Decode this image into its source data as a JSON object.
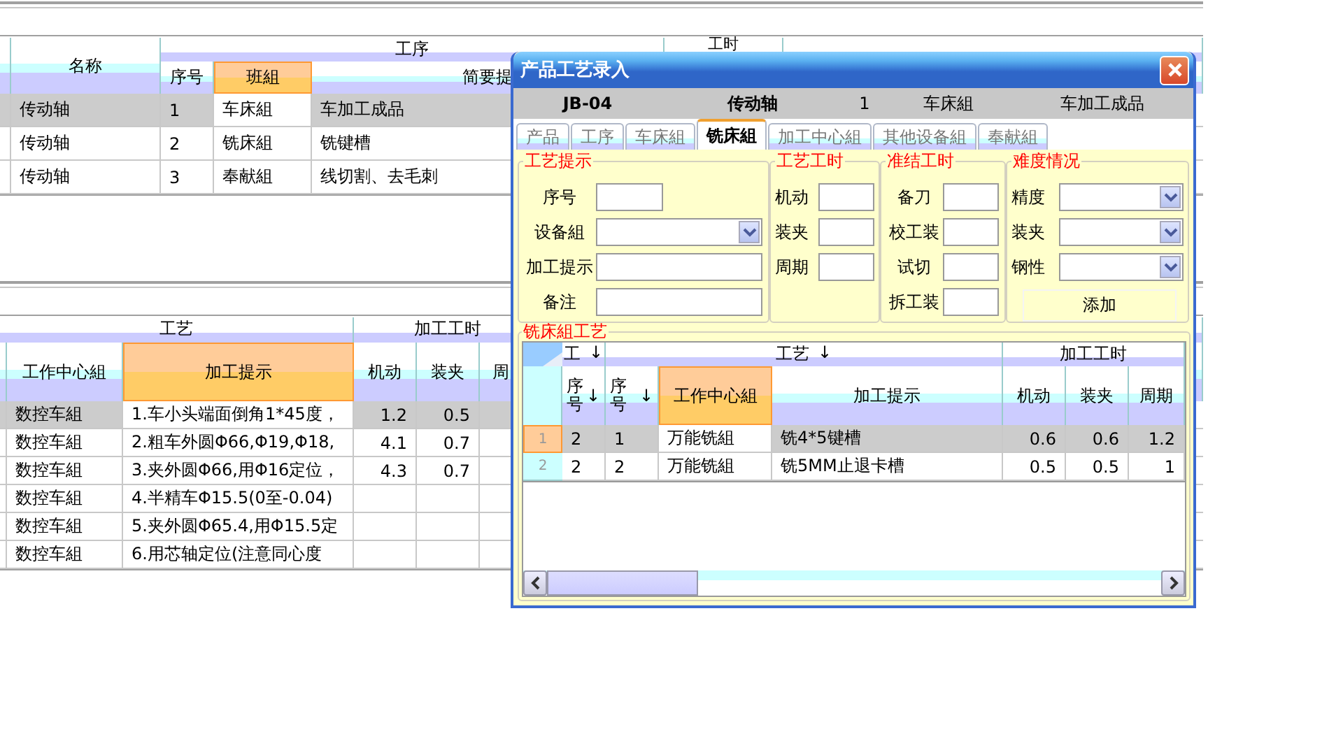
{
  "process_table": {
    "groups": [
      "工序",
      "工时"
    ],
    "columns": [
      {
        "label": "名称",
        "highlighted": false
      },
      {
        "label": "序号",
        "highlighted": false
      },
      {
        "label": "班組",
        "highlighted": true
      },
      {
        "label": "简要提",
        "highlighted": false
      }
    ],
    "rows": [
      {
        "selected": true,
        "cells": [
          "传动轴",
          "1",
          "车床組",
          "车加工成品"
        ]
      },
      {
        "selected": false,
        "cells": [
          "传动轴",
          "2",
          "铣床組",
          "铣键槽"
        ]
      },
      {
        "selected": false,
        "cells": [
          "传动轴",
          "3",
          "奉献組",
          "线切割、去毛刺"
        ]
      }
    ]
  },
  "craft_table": {
    "groups": [
      "工艺",
      "加工工时"
    ],
    "columns": [
      {
        "label": "工作中心組",
        "highlighted": false
      },
      {
        "label": "加工提示",
        "highlighted": true
      },
      {
        "label": "机动",
        "highlighted": false
      },
      {
        "label": "装夹",
        "highlighted": false
      },
      {
        "label": "周",
        "highlighted": false
      }
    ],
    "rows": [
      {
        "selected": true,
        "cells": [
          "数控车組",
          "1.车小头端面倒角1*45度，",
          "1.2",
          "0.5"
        ]
      },
      {
        "selected": false,
        "cells": [
          "数控车組",
          "2.粗车外圆Φ66,Φ19,Φ18,",
          "4.1",
          "0.7"
        ]
      },
      {
        "selected": false,
        "cells": [
          "数控车組",
          "3.夹外圆Φ66,用Φ16定位，",
          "4.3",
          "0.7"
        ]
      },
      {
        "selected": false,
        "cells": [
          "数控车組",
          "4.半精车Φ15.5(0至-0.04)"
        ]
      },
      {
        "selected": false,
        "cells": [
          "数控车組",
          "5.夹外圆Φ65.4,用Φ15.5定"
        ]
      },
      {
        "selected": false,
        "cells": [
          "数控车組",
          "6.用芯轴定位(注意同心度"
        ]
      }
    ]
  },
  "dialog": {
    "title": "产品工艺录入",
    "info": [
      "JB-04",
      "传动轴",
      "1",
      "车床組",
      "车加工成品"
    ],
    "tabs": [
      {
        "label": "产品",
        "selected": false
      },
      {
        "label": "工序",
        "selected": false
      },
      {
        "label": "车床組",
        "selected": false
      },
      {
        "label": "铣床組",
        "selected": true
      },
      {
        "label": "加工中心組",
        "selected": false
      },
      {
        "label": "其他设备組",
        "selected": false
      },
      {
        "label": "奉献組",
        "selected": false
      }
    ],
    "groups": [
      {
        "title": "工艺提示",
        "fields": [
          {
            "label": "序号",
            "kind": "short"
          },
          {
            "label": "设备組",
            "kind": "combo"
          },
          {
            "label": "加工提示",
            "kind": "text"
          },
          {
            "label": "备注",
            "kind": "text"
          }
        ]
      },
      {
        "title": "工艺工时",
        "fields": [
          {
            "label": "机动",
            "kind": "short"
          },
          {
            "label": "装夹",
            "kind": "short"
          },
          {
            "label": "周期",
            "kind": "short"
          }
        ]
      },
      {
        "title": "准结工时",
        "fields": [
          {
            "label": "备刀",
            "kind": "short"
          },
          {
            "label": "校工装",
            "kind": "short"
          },
          {
            "label": "试切",
            "kind": "short"
          },
          {
            "label": "拆工装",
            "kind": "short"
          }
        ]
      },
      {
        "title": "难度情况",
        "fields": [
          {
            "label": "精度",
            "kind": "combo"
          },
          {
            "label": "装夹",
            "kind": "combo"
          },
          {
            "label": "钢性",
            "kind": "combo"
          }
        ]
      }
    ],
    "add_button": "添加",
    "grid": {
      "title": "铣床組工艺",
      "groups": [
        {
          "label": "工",
          "arrow": "↓"
        },
        {
          "label": "工艺",
          "arrow": "↓"
        },
        {
          "label": "加工工时"
        }
      ],
      "columns": [
        {
          "label": "序号",
          "arrow": "↓",
          "highlighted": false
        },
        {
          "label": "序号",
          "arrow": "↓",
          "highlighted": false
        },
        {
          "label": "工作中心組",
          "highlighted": true
        },
        {
          "label": "加工提示",
          "highlighted": false
        },
        {
          "label": "机动",
          "highlighted": false
        },
        {
          "label": "装夹",
          "highlighted": false
        },
        {
          "label": "周期",
          "highlighted": false
        }
      ],
      "rows": [
        {
          "number": "1",
          "selected": true,
          "cells": [
            "2",
            "1",
            "万能铣組",
            "铣4*5键槽",
            "0.6",
            "0.6",
            "1.2"
          ]
        },
        {
          "number": "2",
          "selected": false,
          "cells": [
            "2",
            "2",
            "万能铣組",
            "铣5MM止退卡槽",
            "0.5",
            "0.5",
            "1"
          ]
        }
      ]
    }
  }
}
